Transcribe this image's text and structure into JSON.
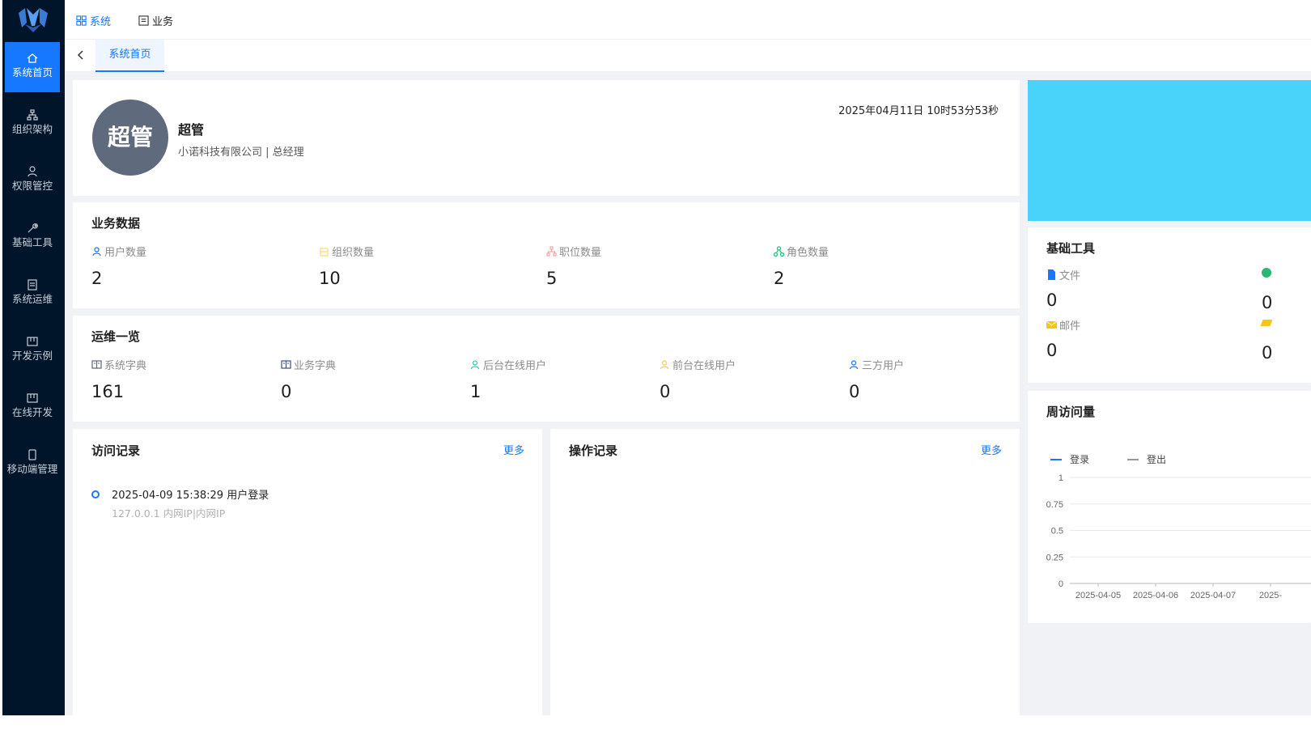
{
  "nav": {
    "items": [
      {
        "label": "系统首页",
        "icon": "home-icon",
        "active": true
      },
      {
        "label": "组织架构",
        "icon": "org-icon"
      },
      {
        "label": "权限管控",
        "icon": "user-icon"
      },
      {
        "label": "基础工具",
        "icon": "wrench-icon"
      },
      {
        "label": "系统运维",
        "icon": "book-icon"
      },
      {
        "label": "开发示例",
        "icon": "window-icon"
      },
      {
        "label": "在线开发",
        "icon": "window-icon"
      },
      {
        "label": "移动端管理",
        "icon": "mobile-icon"
      }
    ]
  },
  "header": {
    "tabs": [
      {
        "label": "系统",
        "active": true
      },
      {
        "label": "业务",
        "active": false
      }
    ]
  },
  "pagetabs": {
    "current": "系统首页"
  },
  "profile": {
    "avatar_text": "超管",
    "name": "超管",
    "subtitle": "小诺科技有限公司 | 总经理",
    "datetime": "2025年04月11日 10时53分53秒"
  },
  "business": {
    "title": "业务数据",
    "stats": [
      {
        "label": "用户数量",
        "value": "2",
        "color": "#1677ff"
      },
      {
        "label": "组织数量",
        "value": "10",
        "color": "#fadb6b"
      },
      {
        "label": "职位数量",
        "value": "5",
        "color": "#f3a6a6"
      },
      {
        "label": "角色数量",
        "value": "2",
        "color": "#2bb673"
      }
    ]
  },
  "ops": {
    "title": "运维一览",
    "stats": [
      {
        "label": "系统字典",
        "value": "161",
        "color": "#5a6478"
      },
      {
        "label": "业务字典",
        "value": "0",
        "color": "#3b4a8a"
      },
      {
        "label": "后台在线用户",
        "value": "1",
        "color": "#2ccfae"
      },
      {
        "label": "前台在线用户",
        "value": "0",
        "color": "#f6c66a"
      },
      {
        "label": "三方用户",
        "value": "0",
        "color": "#1677ff"
      }
    ]
  },
  "visits": {
    "title": "访问记录",
    "more": "更多",
    "records": [
      {
        "main": "2025-04-09 15:38:29 用户登录",
        "sub": "127.0.0.1 内网IP|内网IP"
      }
    ]
  },
  "operations": {
    "title": "操作记录",
    "more": "更多"
  },
  "tools": {
    "title": "基础工具",
    "items": [
      {
        "label": "文件",
        "value": "0",
        "color": "#1677ff"
      },
      {
        "label": "邮件",
        "value": "0",
        "color": "#f5c518"
      }
    ],
    "partial_values": [
      "0",
      "0"
    ]
  },
  "weekly": {
    "title": "周访问量"
  },
  "chart_data": {
    "type": "line",
    "title": "周访问量",
    "x": [
      "2025-04-05",
      "2025-04-06",
      "2025-04-07",
      "2025-"
    ],
    "series": [
      {
        "name": "登录",
        "values": [
          0,
          0,
          0,
          0
        ],
        "color": "#1677ff"
      },
      {
        "name": "登出",
        "values": [
          0,
          0,
          0,
          0
        ],
        "color": "#9a9a9a"
      }
    ],
    "yticks": [
      "1",
      "0.75",
      "0.5",
      "0.25",
      "0"
    ],
    "ylim": [
      0,
      1
    ],
    "grid": true,
    "legend": "top-left"
  }
}
